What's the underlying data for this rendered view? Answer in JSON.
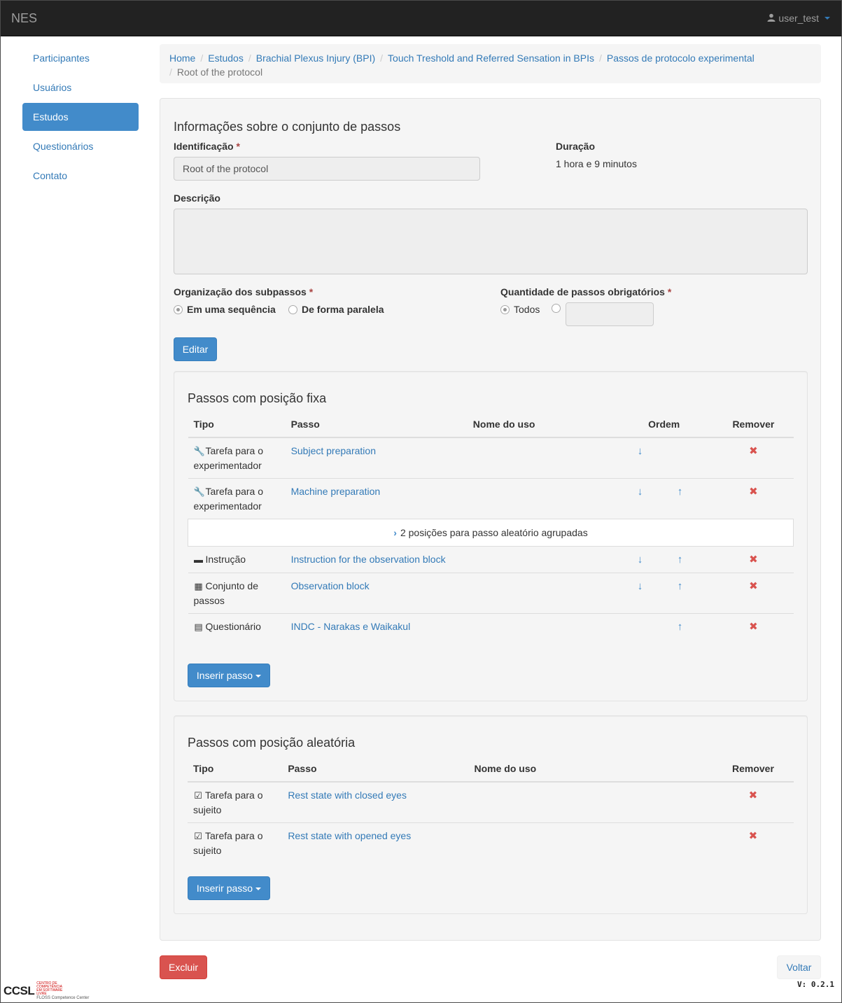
{
  "navbar": {
    "brand": "NES",
    "user": "user_test",
    "user_icon": "user-icon"
  },
  "sidebar": {
    "items": [
      {
        "label": "Participantes"
      },
      {
        "label": "Usuários"
      },
      {
        "label": "Estudos",
        "active": true
      },
      {
        "label": "Questionários"
      },
      {
        "label": "Contato"
      }
    ]
  },
  "breadcrumb": {
    "items": [
      "Home",
      "Estudos",
      "Brachial Plexus Injury (BPI)",
      "Touch Treshold and Referred Sensation in BPIs",
      "Passos de protocolo experimental"
    ],
    "current": "Root of the protocol"
  },
  "form": {
    "title": "Informações sobre o conjunto de passos",
    "identification_label": "Identificação",
    "required_mark": "*",
    "identification_value": "Root of the protocol",
    "duration_label": "Duração",
    "duration_value": "1 hora e 9 minutos",
    "description_label": "Descrição",
    "description_value": "",
    "organization_label": "Organização dos subpassos",
    "organization_options": [
      "Em uma sequência",
      "De forma paralela"
    ],
    "organization_selected": "Em uma sequência",
    "quantity_label": "Quantidade de passos obrigatórios",
    "quantity_option_all": "Todos",
    "quantity_value": "",
    "edit_button": "Editar"
  },
  "fixed_steps": {
    "title": "Passos com posição fixa",
    "headers": {
      "type": "Tipo",
      "step": "Passo",
      "use_name": "Nome do uso",
      "order": "Ordem",
      "remove": "Remover"
    },
    "rows": [
      {
        "icon": "wrench-icon",
        "type": "Tarefa para o experimentador",
        "step": "Subject preparation",
        "down": true,
        "up": false
      },
      {
        "icon": "wrench-icon",
        "type": "Tarefa para o experimentador",
        "step": "Machine preparation",
        "down": true,
        "up": true
      },
      {
        "icon": "comment-icon",
        "type": "Instrução",
        "step": "Instruction for the observation block",
        "down": true,
        "up": true
      },
      {
        "icon": "grid-icon",
        "type": "Conjunto de passos",
        "step": "Observation block",
        "down": true,
        "up": true
      },
      {
        "icon": "list-icon",
        "type": "Questionário",
        "step": "INDC - Narakas e Waikakul",
        "down": false,
        "up": true
      }
    ],
    "group_row": "2 posições para passo aleatório agrupadas",
    "insert_button": "Inserir passo"
  },
  "random_steps": {
    "title": "Passos com posição aleatória",
    "headers": {
      "type": "Tipo",
      "step": "Passo",
      "use_name": "Nome do uso",
      "remove": "Remover"
    },
    "rows": [
      {
        "icon": "check-icon",
        "type": "Tarefa para o sujeito",
        "step": "Rest state with closed eyes"
      },
      {
        "icon": "check-icon",
        "type": "Tarefa para o sujeito",
        "step": "Rest state with opened eyes"
      }
    ],
    "insert_button": "Inserir passo"
  },
  "actions": {
    "delete_button": "Excluir",
    "back_button": "Voltar"
  },
  "footer": {
    "logo": "CCSL",
    "logo_subtitle": "CENTRO DE COMPETÊNCIA EM SOFTWARE LIVRE",
    "logo_tagline": "FLOSS Competence Center",
    "version": "V: 0.2.1"
  }
}
